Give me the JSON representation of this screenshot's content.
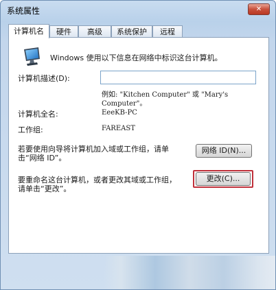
{
  "window": {
    "title": "系统属性",
    "close_glyph": "✕"
  },
  "tabs": [
    {
      "label": "计算机名",
      "active": true
    },
    {
      "label": "硬件",
      "active": false
    },
    {
      "label": "高级",
      "active": false
    },
    {
      "label": "系统保护",
      "active": false
    },
    {
      "label": "远程",
      "active": false
    }
  ],
  "panel": {
    "intro_text": "Windows 使用以下信息在网络中标识这台计算机。",
    "description_label": "计算机描述(D):",
    "description_value": "",
    "example_line1": "例如: \"Kitchen Computer\" 或 \"Mary's",
    "example_line2": "Computer\"。",
    "fullname_label": "计算机全名:",
    "fullname_value": "EeeKB-PC",
    "workgroup_label": "工作组:",
    "workgroup_value": "FAREAST",
    "wizard_text_line1": "若要使用向导将计算机加入域或工作组，请单",
    "wizard_text_line2": "击“网络 ID”。",
    "network_id_button": "网络 ID(N)...",
    "rename_text_line1": "要重命名这台计算机，或者更改其域或工作组，",
    "rename_text_line2": "请单击“更改”。",
    "change_button": "更改(C)..."
  },
  "colors": {
    "highlight": "#c0303a",
    "close": "#c9503c"
  },
  "icons": {
    "computer": "monitor-icon"
  }
}
